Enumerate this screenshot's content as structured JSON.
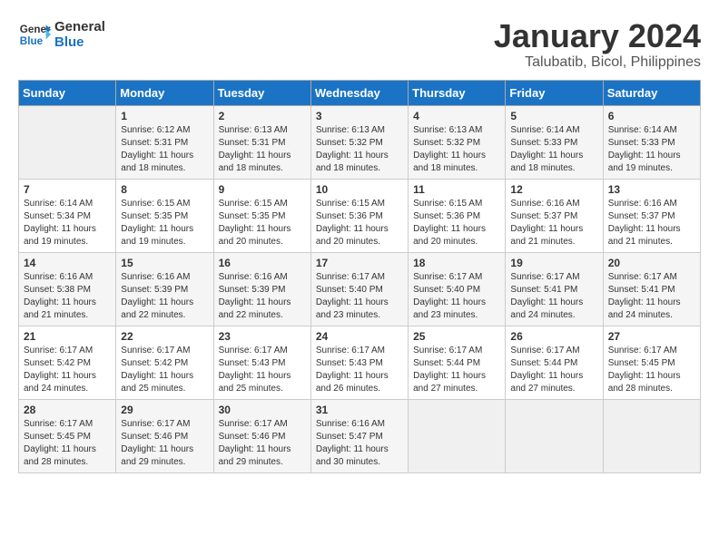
{
  "logo": {
    "line1": "General",
    "line2": "Blue"
  },
  "title": "January 2024",
  "subtitle": "Talubatib, Bicol, Philippines",
  "headers": [
    "Sunday",
    "Monday",
    "Tuesday",
    "Wednesday",
    "Thursday",
    "Friday",
    "Saturday"
  ],
  "weeks": [
    [
      {
        "day": "",
        "content": ""
      },
      {
        "day": "1",
        "content": "Sunrise: 6:12 AM\nSunset: 5:31 PM\nDaylight: 11 hours\nand 18 minutes."
      },
      {
        "day": "2",
        "content": "Sunrise: 6:13 AM\nSunset: 5:31 PM\nDaylight: 11 hours\nand 18 minutes."
      },
      {
        "day": "3",
        "content": "Sunrise: 6:13 AM\nSunset: 5:32 PM\nDaylight: 11 hours\nand 18 minutes."
      },
      {
        "day": "4",
        "content": "Sunrise: 6:13 AM\nSunset: 5:32 PM\nDaylight: 11 hours\nand 18 minutes."
      },
      {
        "day": "5",
        "content": "Sunrise: 6:14 AM\nSunset: 5:33 PM\nDaylight: 11 hours\nand 18 minutes."
      },
      {
        "day": "6",
        "content": "Sunrise: 6:14 AM\nSunset: 5:33 PM\nDaylight: 11 hours\nand 19 minutes."
      }
    ],
    [
      {
        "day": "7",
        "content": "Sunrise: 6:14 AM\nSunset: 5:34 PM\nDaylight: 11 hours\nand 19 minutes."
      },
      {
        "day": "8",
        "content": "Sunrise: 6:15 AM\nSunset: 5:35 PM\nDaylight: 11 hours\nand 19 minutes."
      },
      {
        "day": "9",
        "content": "Sunrise: 6:15 AM\nSunset: 5:35 PM\nDaylight: 11 hours\nand 20 minutes."
      },
      {
        "day": "10",
        "content": "Sunrise: 6:15 AM\nSunset: 5:36 PM\nDaylight: 11 hours\nand 20 minutes."
      },
      {
        "day": "11",
        "content": "Sunrise: 6:15 AM\nSunset: 5:36 PM\nDaylight: 11 hours\nand 20 minutes."
      },
      {
        "day": "12",
        "content": "Sunrise: 6:16 AM\nSunset: 5:37 PM\nDaylight: 11 hours\nand 21 minutes."
      },
      {
        "day": "13",
        "content": "Sunrise: 6:16 AM\nSunset: 5:37 PM\nDaylight: 11 hours\nand 21 minutes."
      }
    ],
    [
      {
        "day": "14",
        "content": "Sunrise: 6:16 AM\nSunset: 5:38 PM\nDaylight: 11 hours\nand 21 minutes."
      },
      {
        "day": "15",
        "content": "Sunrise: 6:16 AM\nSunset: 5:39 PM\nDaylight: 11 hours\nand 22 minutes."
      },
      {
        "day": "16",
        "content": "Sunrise: 6:16 AM\nSunset: 5:39 PM\nDaylight: 11 hours\nand 22 minutes."
      },
      {
        "day": "17",
        "content": "Sunrise: 6:17 AM\nSunset: 5:40 PM\nDaylight: 11 hours\nand 23 minutes."
      },
      {
        "day": "18",
        "content": "Sunrise: 6:17 AM\nSunset: 5:40 PM\nDaylight: 11 hours\nand 23 minutes."
      },
      {
        "day": "19",
        "content": "Sunrise: 6:17 AM\nSunset: 5:41 PM\nDaylight: 11 hours\nand 24 minutes."
      },
      {
        "day": "20",
        "content": "Sunrise: 6:17 AM\nSunset: 5:41 PM\nDaylight: 11 hours\nand 24 minutes."
      }
    ],
    [
      {
        "day": "21",
        "content": "Sunrise: 6:17 AM\nSunset: 5:42 PM\nDaylight: 11 hours\nand 24 minutes."
      },
      {
        "day": "22",
        "content": "Sunrise: 6:17 AM\nSunset: 5:42 PM\nDaylight: 11 hours\nand 25 minutes."
      },
      {
        "day": "23",
        "content": "Sunrise: 6:17 AM\nSunset: 5:43 PM\nDaylight: 11 hours\nand 25 minutes."
      },
      {
        "day": "24",
        "content": "Sunrise: 6:17 AM\nSunset: 5:43 PM\nDaylight: 11 hours\nand 26 minutes."
      },
      {
        "day": "25",
        "content": "Sunrise: 6:17 AM\nSunset: 5:44 PM\nDaylight: 11 hours\nand 27 minutes."
      },
      {
        "day": "26",
        "content": "Sunrise: 6:17 AM\nSunset: 5:44 PM\nDaylight: 11 hours\nand 27 minutes."
      },
      {
        "day": "27",
        "content": "Sunrise: 6:17 AM\nSunset: 5:45 PM\nDaylight: 11 hours\nand 28 minutes."
      }
    ],
    [
      {
        "day": "28",
        "content": "Sunrise: 6:17 AM\nSunset: 5:45 PM\nDaylight: 11 hours\nand 28 minutes."
      },
      {
        "day": "29",
        "content": "Sunrise: 6:17 AM\nSunset: 5:46 PM\nDaylight: 11 hours\nand 29 minutes."
      },
      {
        "day": "30",
        "content": "Sunrise: 6:17 AM\nSunset: 5:46 PM\nDaylight: 11 hours\nand 29 minutes."
      },
      {
        "day": "31",
        "content": "Sunrise: 6:16 AM\nSunset: 5:47 PM\nDaylight: 11 hours\nand 30 minutes."
      },
      {
        "day": "",
        "content": ""
      },
      {
        "day": "",
        "content": ""
      },
      {
        "day": "",
        "content": ""
      }
    ]
  ]
}
